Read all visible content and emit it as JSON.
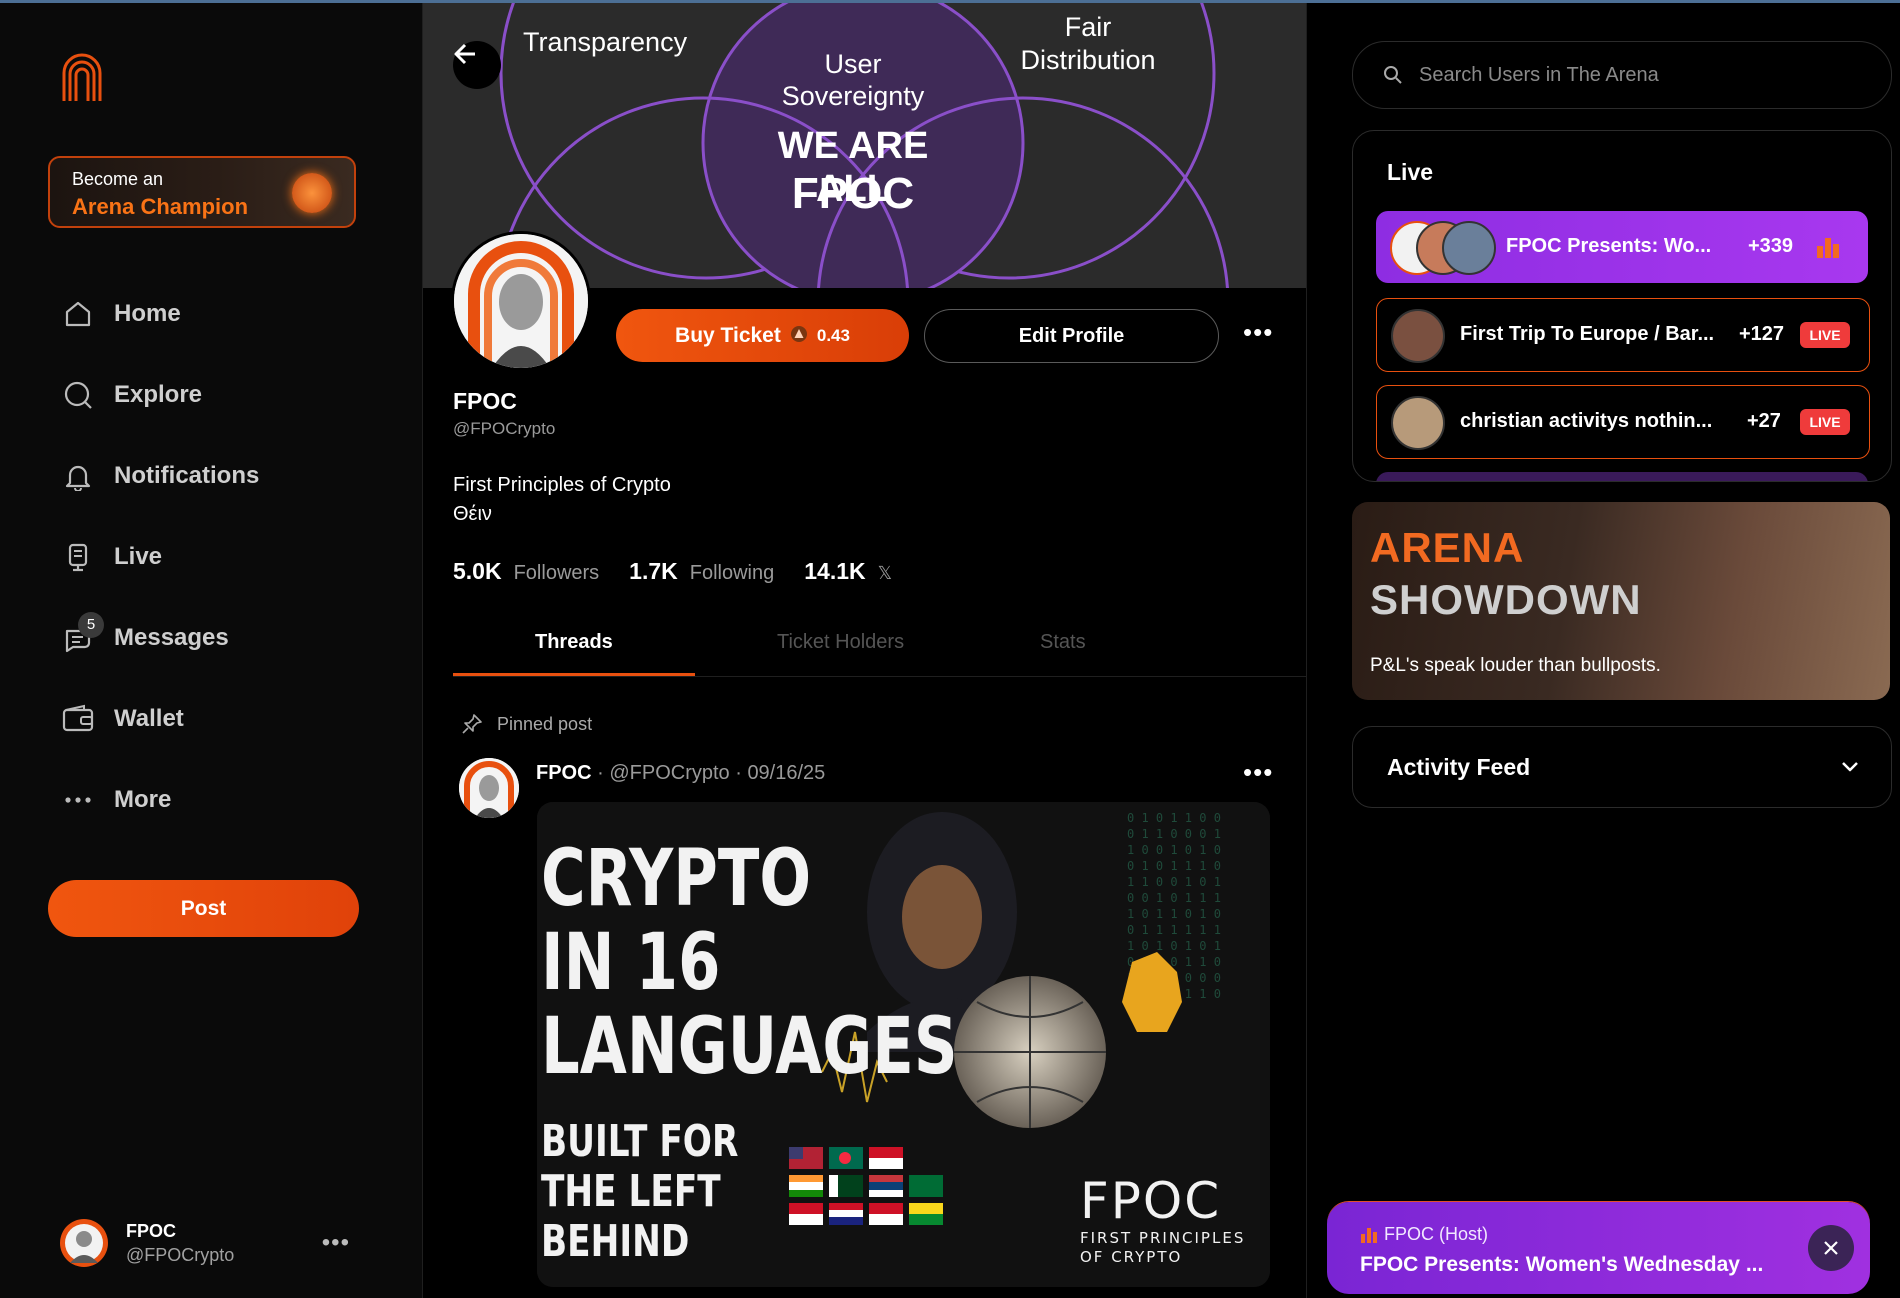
{
  "sidebar": {
    "champion": {
      "line1": "Become an",
      "line2": "Arena Champion"
    },
    "nav": [
      {
        "label": "Home",
        "icon": "home-icon"
      },
      {
        "label": "Explore",
        "icon": "search-icon"
      },
      {
        "label": "Notifications",
        "icon": "bell-icon"
      },
      {
        "label": "Live",
        "icon": "live-icon"
      },
      {
        "label": "Messages",
        "icon": "message-icon",
        "badge": "5"
      },
      {
        "label": "Wallet",
        "icon": "wallet-icon"
      },
      {
        "label": "More",
        "icon": "more-dots-icon"
      }
    ],
    "post_label": "Post",
    "user": {
      "name": "FPOC",
      "handle": "@FPOCrypto"
    }
  },
  "banner": {
    "transparency": "Transparency",
    "user_sov_1": "User",
    "user_sov_2": "Sovereignty",
    "fair_1": "Fair",
    "fair_2": "Distribution",
    "we_are_all": "WE ARE ALL",
    "fpoc": "FPOC"
  },
  "profile": {
    "buy_label": "Buy Ticket",
    "price": "0.43",
    "edit_label": "Edit Profile",
    "name": "FPOC",
    "handle": "@FPOCrypto",
    "bio_line1": "First Principles of Crypto",
    "bio_line2": "Θέιν",
    "followers_value": "5.0K",
    "followers_label": "Followers",
    "following_value": "1.7K",
    "following_label": "Following",
    "x_value": "14.1K",
    "x_glyph": "𝕏"
  },
  "tabs": {
    "threads": "Threads",
    "ticket_holders": "Ticket Holders",
    "stats": "Stats"
  },
  "post": {
    "pinned_label": "Pinned post",
    "author": "FPOC",
    "meta": "· @FPOCrypto · 09/16/25",
    "image": {
      "line1": "CRYPTO",
      "line2": "IN 16",
      "line3": "LANGUAGES",
      "sub1": "BUILT FOR",
      "sub2": "THE LEFT",
      "sub3": "BEHIND",
      "brand": "FPOC",
      "brand_sub1": "FIRST PRINCIPLES",
      "brand_sub2": "OF CRYPTO"
    }
  },
  "right": {
    "search_placeholder": "Search Users in The Arena",
    "live_title": "Live",
    "live_items": [
      {
        "title": "FPOC Presents: Wo...",
        "count": "+339",
        "active": true
      },
      {
        "title": "First Trip To Europe / Bar...",
        "count": "+127",
        "tag": "LIVE"
      },
      {
        "title": "christian activitys nothin...",
        "count": "+27",
        "tag": "LIVE"
      }
    ],
    "showdown": {
      "title1": "ARENA",
      "title2": "SHOWDOWN",
      "tagline": "P&L's speak louder than bullposts."
    },
    "activity_label": "Activity Feed",
    "toast": {
      "host": "FPOC (Host)",
      "title": "FPOC Presents: Women's Wednesday ..."
    }
  },
  "colors": {
    "accent": "#e8500f",
    "live_purple": "#9b30ee",
    "live_red": "#ef3b3b"
  }
}
